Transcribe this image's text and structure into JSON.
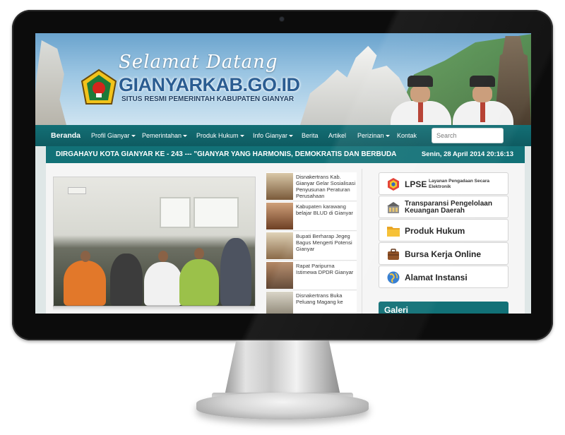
{
  "banner": {
    "welcome": "Selamat Datang",
    "site_name": "GIANYARKAB.GO.ID",
    "subtitle": "SITUS RESMI PEMERINTAH KABUPATEN GIANYAR"
  },
  "navbar": {
    "items": [
      {
        "label": "Beranda",
        "dropdown": false
      },
      {
        "label": "Profil Gianyar",
        "dropdown": true
      },
      {
        "label": "Pemerintahan",
        "dropdown": true
      },
      {
        "label": "Produk Hukum",
        "dropdown": true
      },
      {
        "label": "Info Gianyar",
        "dropdown": true
      },
      {
        "label": "Berita",
        "dropdown": false
      },
      {
        "label": "Artikel",
        "dropdown": false
      },
      {
        "label": "Perizinan",
        "dropdown": true
      },
      {
        "label": "Kontak",
        "dropdown": false
      }
    ],
    "search_placeholder": "Search"
  },
  "ticker": {
    "text": "DIRGAHAYU KOTA GIANYAR KE - 243 --- \"GIANYAR YANG HARMONIS, DEMOKRATIS DAN BERBUDA",
    "datetime": "Senin, 28 April 2014 20:16:13"
  },
  "news": [
    {
      "title": "Disnakertrans Kab. Gianyar Gelar Sosialisasi Penyusunan Peraturan Perusahaan"
    },
    {
      "title": "Kabupaten karawang belajar BLUD di Gianyar"
    },
    {
      "title": "Bupati Berharap Jegeg Bagus Mengerti Potensi Gianyar"
    },
    {
      "title": "Rapat Paripurna Istimewa DPDR Gianyar"
    },
    {
      "title": "Disnakertrans Buka Peluang Magang ke"
    }
  ],
  "sidebar": {
    "lpse": {
      "label": "LPSE",
      "sub": "Layanan Pengadaan Secara Elektronik"
    },
    "transparansi": "Transparansi Pengelolaan Keuangan Daerah",
    "produk_hukum": "Produk Hukum",
    "bursa_kerja": "Bursa Kerja Online",
    "alamat": "Alamat Instansi",
    "galeri": "Galeri"
  },
  "colors": {
    "nav_bg": "#136f75",
    "ticker_bg": "#127177",
    "site_name": "#2b5d92",
    "bezel": "#0c0c0c"
  },
  "icons": {
    "lpse": "lpse-hexagon-icon",
    "transparansi": "finance-building-icon",
    "produk_hukum": "folder-icon",
    "bursa_kerja": "briefcase-icon",
    "alamat": "globe-icon"
  }
}
